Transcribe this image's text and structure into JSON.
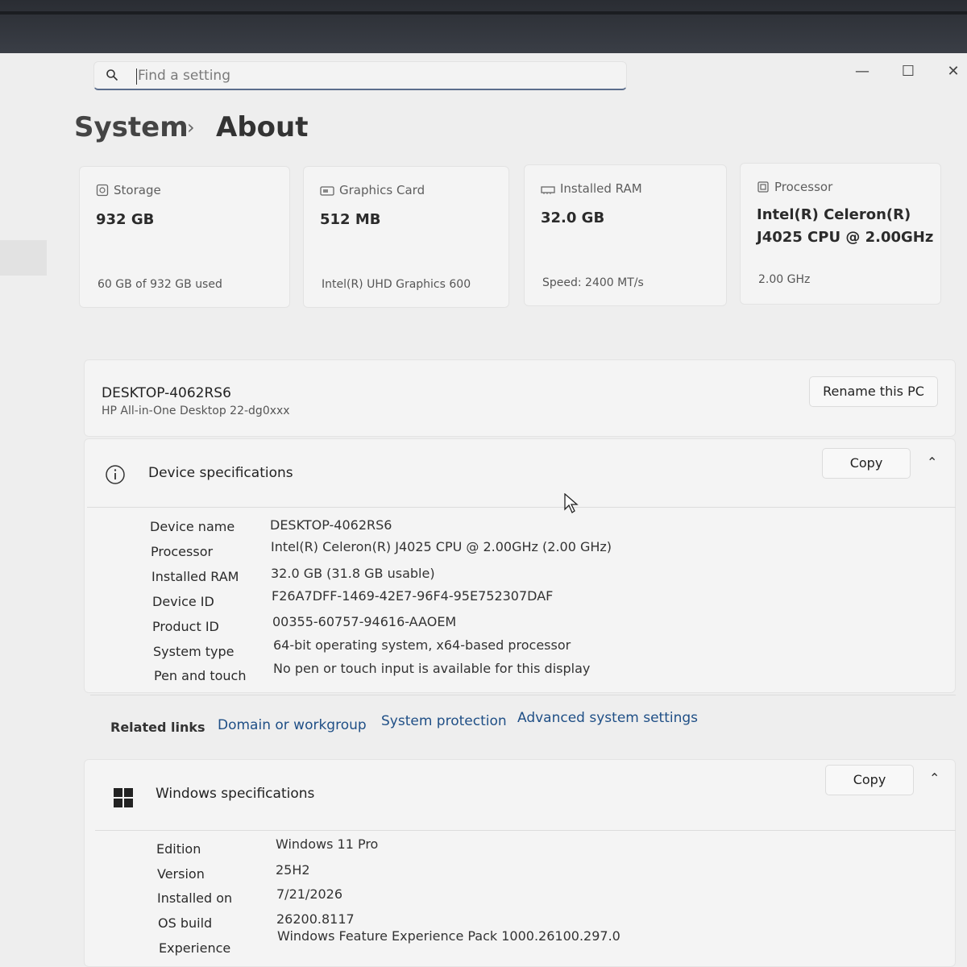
{
  "search": {
    "placeholder": "Find a setting"
  },
  "window_controls": {
    "minimize": "—",
    "maximize": "☐",
    "close": "✕"
  },
  "breadcrumb": {
    "parent": "System",
    "separator": "›",
    "current": "About"
  },
  "tiles": [
    {
      "icon": "storage-icon",
      "title": "Storage",
      "value": "932 GB",
      "footer": "60 GB of 932 GB used"
    },
    {
      "icon": "graphics-card-icon",
      "title": "Graphics Card",
      "value": "512 MB",
      "footer": "Intel(R) UHD Graphics 600"
    },
    {
      "icon": "ram-icon",
      "title": "Installed RAM",
      "value": "32.0 GB",
      "footer": "Speed: 2400 MT/s"
    },
    {
      "icon": "processor-icon",
      "title": "Processor",
      "value_line1": "Intel(R) Celeron(R)",
      "value_line2": "J4025 CPU @ 2.00GHz",
      "footer": "2.00 GHz"
    }
  ],
  "pc": {
    "name": "DESKTOP-4062RS6",
    "model": "HP All-in-One Desktop 22-dg0xxx",
    "rename_label": "Rename this PC"
  },
  "device_specs": {
    "title": "Device specifications",
    "copy_label": "Copy",
    "rows": [
      {
        "label": "Device name",
        "value": "DESKTOP-4062RS6"
      },
      {
        "label": "Processor",
        "value": "Intel(R) Celeron(R) J4025 CPU @ 2.00GHz (2.00 GHz)"
      },
      {
        "label": "Installed RAM",
        "value": "32.0 GB (31.8 GB usable)"
      },
      {
        "label": "Device ID",
        "value": "F26A7DFF-1469-42E7-96F4-95E752307DAF"
      },
      {
        "label": "Product ID",
        "value": "00355-60757-94616-AAOEM"
      },
      {
        "label": "System type",
        "value": "64-bit operating system, x64-based processor"
      },
      {
        "label": "Pen and touch",
        "value": "No pen or touch input is available for this display"
      }
    ]
  },
  "related_links": {
    "title": "Related links",
    "links": [
      "Domain or workgroup",
      "System protection",
      "Advanced system settings"
    ]
  },
  "windows_specs": {
    "title": "Windows specifications",
    "copy_label": "Copy",
    "rows": [
      {
        "label": "Edition",
        "value": "Windows 11 Pro"
      },
      {
        "label": "Version",
        "value": "25H2"
      },
      {
        "label": "Installed on",
        "value": "7/21/2026"
      },
      {
        "label": "OS build",
        "value": "26200.8117"
      },
      {
        "label": "Experience",
        "value": "Windows Feature Experience Pack 1000.26100.297.0"
      }
    ]
  }
}
